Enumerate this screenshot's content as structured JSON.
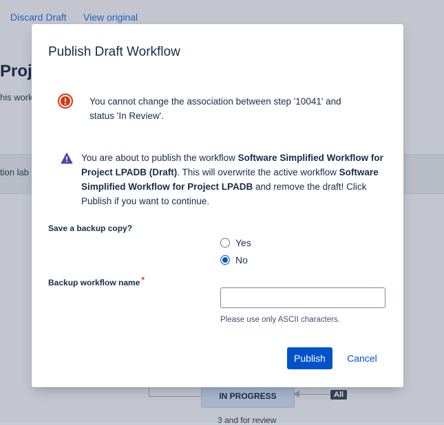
{
  "background": {
    "links": [
      "Discard Draft",
      "View original"
    ],
    "page_title": "Proje",
    "page_subtitle": "his work",
    "band_label": "tion lab",
    "status_box": "IN PROGRESS",
    "all_badge": "All",
    "bottom_text": "3 and for review"
  },
  "modal": {
    "title": "Publish Draft Workflow",
    "error": {
      "icon": "error-circle-icon",
      "message": "You cannot change the association between step '10041' and status 'In Review'."
    },
    "warning": {
      "icon": "warning-triangle-icon",
      "text_1": "You are about to publish the workflow ",
      "bold_1": "Software Simplified Workflow for Project LPADB (Draft)",
      "text_2": ". This will overwrite the active workflow ",
      "bold_2": "Software Simplified Workflow for Project LPADB",
      "text_3": " and remove the draft! Click Publish if you want to continue."
    },
    "backup_label": "Save a backup copy?",
    "radio_yes": "Yes",
    "radio_no": "No",
    "selected": "No",
    "name_label": "Backup workflow name",
    "required_mark": "*",
    "name_value": "",
    "help_text": "Please use only ASCII characters.",
    "publish_label": "Publish",
    "cancel_label": "Cancel"
  },
  "colors": {
    "primary": "#0052cc",
    "error": "#de350b",
    "warning": "#5243aa"
  }
}
